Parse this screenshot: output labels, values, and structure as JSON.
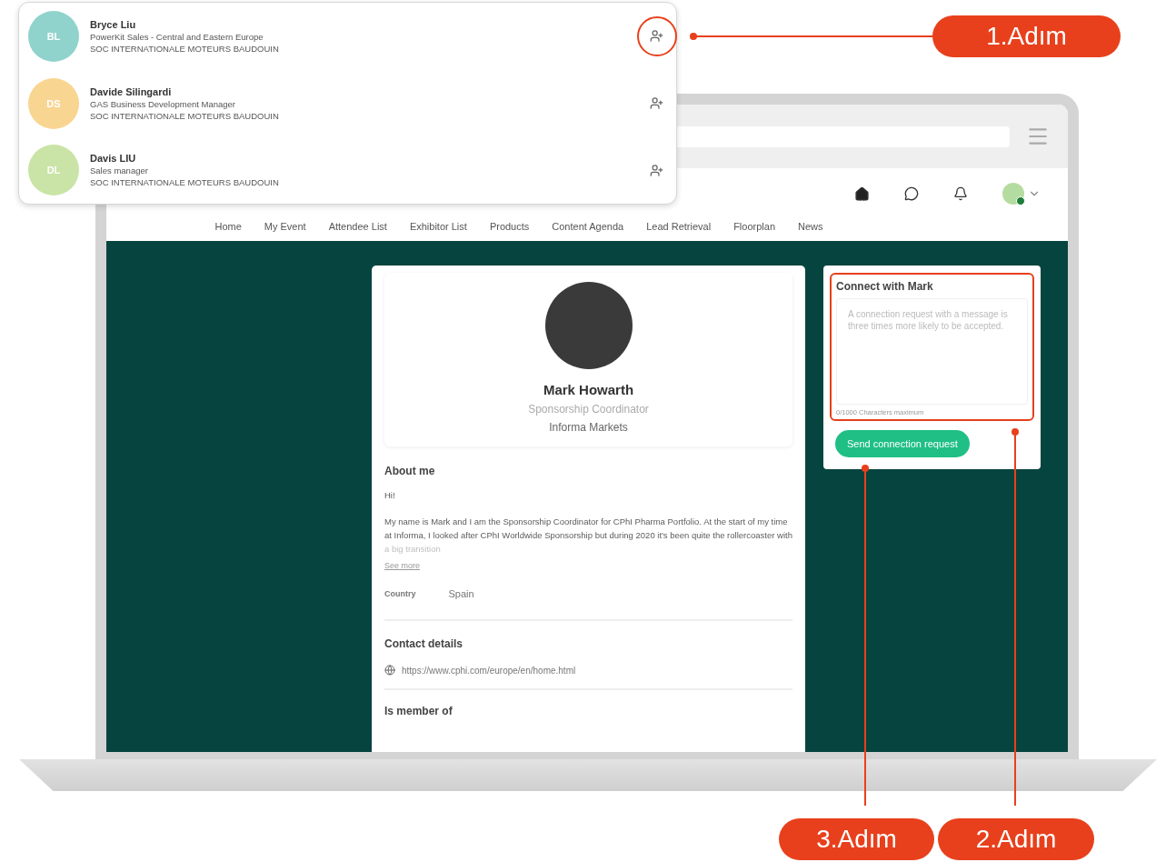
{
  "popup": {
    "contacts": [
      {
        "initials": "BL",
        "name": "Bryce Liu",
        "title": "PowerKit Sales - Central and Eastern Europe",
        "company": "SOC INTERNATIONALE MOTEURS BAUDOUIN",
        "color": "#8fd3cc"
      },
      {
        "initials": "DS",
        "name": "Davide Silingardi",
        "title": "GAS Business Development Manager",
        "company": "SOC INTERNATIONALE MOTEURS BAUDOUIN",
        "color": "#f9d592"
      },
      {
        "initials": "DL",
        "name": "Davis LIU",
        "title": "Sales manager",
        "company": "SOC INTERNATIONALE MOTEURS BAUDOUIN",
        "color": "#c9e4a6"
      }
    ]
  },
  "nav": [
    "Home",
    "My Event",
    "Attendee List",
    "Exhibitor List",
    "Products",
    "Content Agenda",
    "Lead Retrieval",
    "Floorplan",
    "News"
  ],
  "profile": {
    "name": "Mark Howarth",
    "role": "Sponsorship Coordinator",
    "company": "Informa Markets",
    "about": {
      "heading": "About me",
      "greeting": "Hi!",
      "body": "My name is Mark and I am the Sponsorship Coordinator for CPhI Pharma Portfolio. At the start of my time at Informa, I looked after CPhI Worldwide Sponsorship but during 2020 it's been quite the rollercoaster with a big transition",
      "link": "See more"
    },
    "fields": [
      {
        "label": "Country",
        "value": "Spain"
      }
    ],
    "contact": {
      "heading": "Contact details",
      "url": "https://www.cphi.com/europe/en/home.html"
    },
    "member": {
      "heading": "Is member of"
    }
  },
  "connect": {
    "title": "Connect with Mark",
    "placeholder": "A connection request with a message is three times more likely to be accepted.",
    "counter": "0/1000 Characters maximum",
    "button": "Send connection request"
  },
  "callouts": [
    {
      "label": "1.Adım"
    },
    {
      "label": "3.Adım"
    },
    {
      "label": "2.Adım"
    }
  ]
}
